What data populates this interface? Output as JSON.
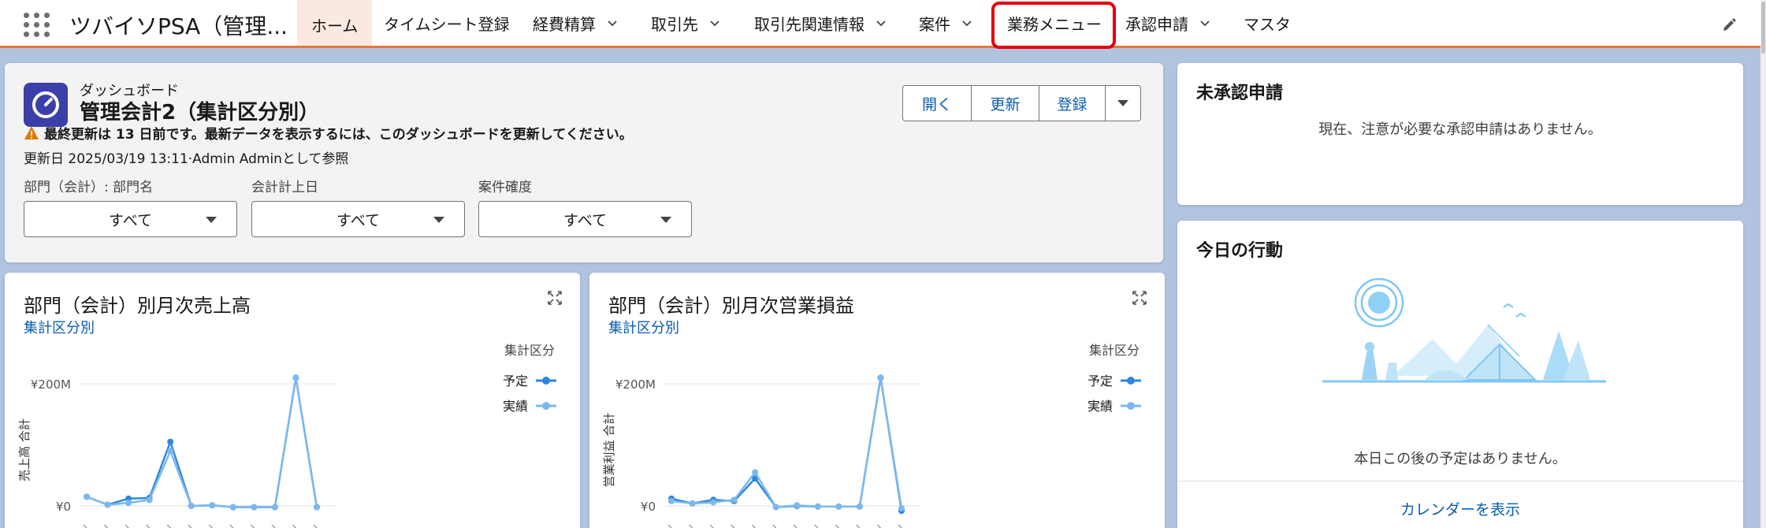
{
  "nav": {
    "app_name": "ツバイソPSA（管理...",
    "tabs": [
      {
        "label": "ホーム",
        "active": true,
        "chevron": false
      },
      {
        "label": "タイムシート登録",
        "active": false,
        "chevron": false
      },
      {
        "label": "経費精算",
        "active": false,
        "chevron": true
      },
      {
        "label": "取引先",
        "active": false,
        "chevron": true
      },
      {
        "label": "取引先関連情報",
        "active": false,
        "chevron": true
      },
      {
        "label": "案件",
        "active": false,
        "chevron": true
      },
      {
        "label": "業務メニュー",
        "active": false,
        "chevron": false,
        "highlighted": true
      },
      {
        "label": "承認申請",
        "active": false,
        "chevron": true
      },
      {
        "label": "マスタ",
        "active": false,
        "chevron": false
      }
    ],
    "accent_color": "#e4763c",
    "highlight_color": "#e3000f"
  },
  "dashboard": {
    "kicker": "ダッシュボード",
    "title": "管理会計2（集計区分別）",
    "warning": "最終更新は 13 日前です。最新データを表示するには、このダッシュボードを更新してください。",
    "updated": "更新日 2025/03/19 13:11·Admin Adminとして参照",
    "buttons": {
      "open": "開く",
      "refresh": "更新",
      "register": "登録"
    },
    "filters": [
      {
        "label": "部門（会計）: 部門名",
        "value": "すべて"
      },
      {
        "label": "会計計上日",
        "value": "すべて"
      },
      {
        "label": "案件確度",
        "value": "すべて"
      }
    ]
  },
  "charts": [
    {
      "title": "部門（会計）別月次売上高",
      "subtitle": "集計区分別",
      "legend_title": "集計区分",
      "chart_data": {
        "type": "line",
        "ylabel": "売上高 合計",
        "yticks": [
          "¥200M",
          "¥0"
        ],
        "ylim": [
          0,
          200
        ],
        "series": [
          {
            "name": "予定",
            "color": "#2e86de",
            "values": [
              15,
              2,
              12,
              13,
              105,
              0,
              1,
              -2,
              -2,
              -2,
              210,
              -2
            ]
          },
          {
            "name": "実績",
            "color": "#7cb8ee",
            "values": [
              15,
              2,
              5,
              10,
              90,
              0,
              1,
              -2,
              -2,
              -2,
              210,
              -2
            ]
          }
        ]
      }
    },
    {
      "title": "部門（会計）別月次営業損益",
      "subtitle": "集計区分別",
      "legend_title": "集計区分",
      "chart_data": {
        "type": "line",
        "ylabel": "営業利益 合計",
        "yticks": [
          "¥200M",
          "¥0"
        ],
        "ylim": [
          0,
          200
        ],
        "series": [
          {
            "name": "予定",
            "color": "#2e86de",
            "values": [
              12,
              4,
              10,
              8,
              45,
              -2,
              0,
              -1,
              -1,
              -1,
              210,
              -8
            ]
          },
          {
            "name": "実績",
            "color": "#7cb8ee",
            "values": [
              8,
              4,
              6,
              10,
              55,
              -2,
              1,
              -1,
              -1,
              -1,
              210,
              -4
            ]
          }
        ]
      }
    }
  ],
  "approval": {
    "title": "未承認申請",
    "message": "現在、注意が必要な承認申請はありません。"
  },
  "today": {
    "title": "今日の行動",
    "message": "本日この後の予定はありません。",
    "link": "カレンダーを表示"
  }
}
